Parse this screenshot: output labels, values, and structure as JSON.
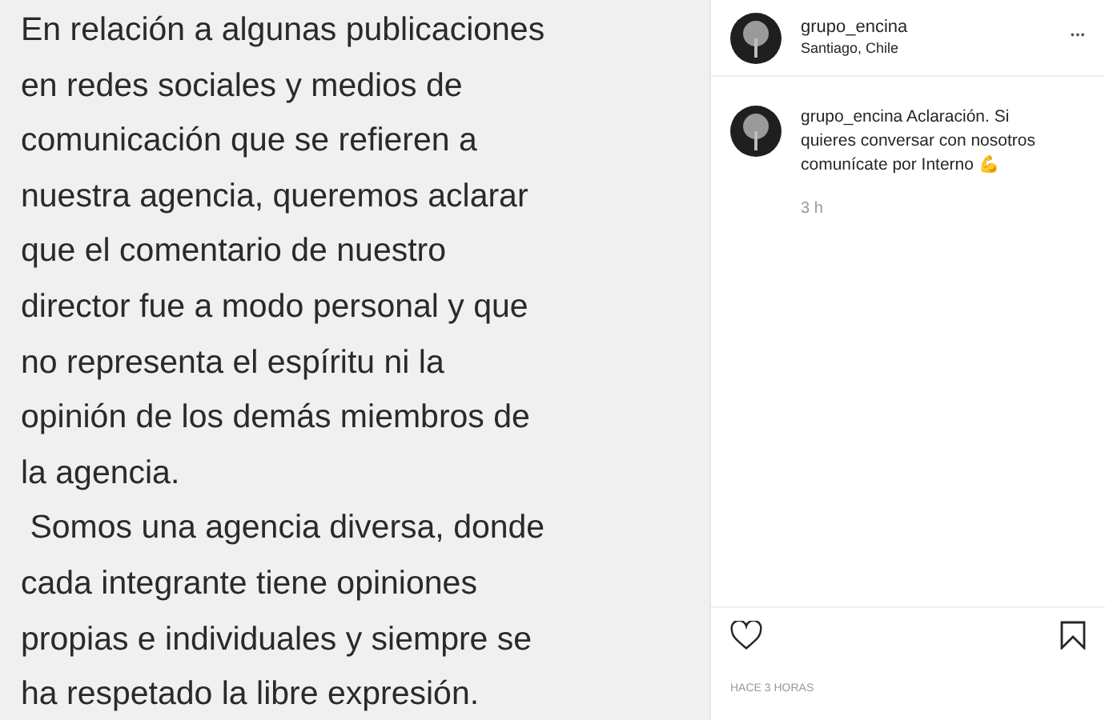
{
  "post_image": {
    "paragraphs": [
      [
        "En relación a algunas publicaciones",
        "en redes sociales y medios de",
        "comunicación que se refieren a",
        "nuestra agencia, queremos aclarar",
        "que el comentario de nuestro",
        "director fue a modo personal y que",
        "no representa el espíritu ni la",
        "opinión de los demás miembros de",
        "la agencia."
      ],
      [
        " Somos una agencia diversa, donde",
        "cada integrante tiene opiniones",
        "propias e individuales y siempre se",
        "ha respetado la libre expresión."
      ]
    ]
  },
  "header": {
    "username": "grupo_encina",
    "location": "Santiago, Chile",
    "more": "•••"
  },
  "caption": {
    "username": "grupo_encina",
    "text": "Aclaración. Si quieres conversar con nosotros comunícate por Interno",
    "emoji": "💪",
    "time": "3 h"
  },
  "actions": {
    "liked": false,
    "saved": false
  },
  "timestamp": "HACE 3 HORAS"
}
